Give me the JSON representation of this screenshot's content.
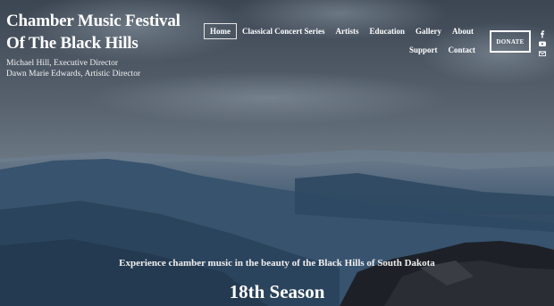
{
  "brand": {
    "title_line1": "Chamber Music Festival",
    "title_line2": "Of The Black Hills",
    "executive": "Michael Hill, Executive Director",
    "artistic": "Dawn Marie Edwards, Artistic Director"
  },
  "nav": {
    "items": [
      {
        "label": "Home",
        "active": true
      },
      {
        "label": "Classical Concert Series"
      },
      {
        "label": "Artists"
      },
      {
        "label": "Education"
      },
      {
        "label": "Gallery"
      },
      {
        "label": "About"
      },
      {
        "label": "Support"
      },
      {
        "label": "Contact"
      }
    ]
  },
  "donate": {
    "label": "DONATE"
  },
  "social": {
    "icons": [
      "facebook-icon",
      "youtube-icon",
      "email-icon"
    ]
  },
  "hero": {
    "tagline": "Experience chamber music in the beauty of the Black Hills of South Dakota",
    "season": "18th Season"
  },
  "colors": {
    "sky_top": "#424c59",
    "sky_mid": "#6c7a87",
    "hills": "#2f4b66",
    "rock": "#1f2228"
  }
}
